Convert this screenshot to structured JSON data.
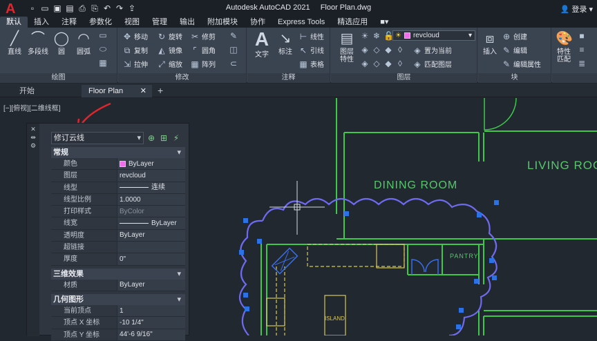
{
  "app": {
    "title_app": "Autodesk AutoCAD 2021",
    "title_doc": "Floor Plan.dwg",
    "signin_label": "登录"
  },
  "ribbon_tabs": [
    "默认",
    "插入",
    "注释",
    "参数化",
    "视图",
    "管理",
    "输出",
    "附加模块",
    "协作",
    "Express Tools",
    "精选应用"
  ],
  "ribbon": {
    "draw": {
      "title": "绘图",
      "line": "直线",
      "polyline": "多段线",
      "circle": "圆",
      "arc": "圆弧"
    },
    "modify": {
      "title": "修改",
      "move": "移动",
      "rotate": "旋转",
      "trim": "修剪",
      "copy": "复制",
      "mirror": "镜像",
      "fillet": "圆角",
      "stretch": "拉伸",
      "scale": "缩放",
      "array": "阵列"
    },
    "annotation": {
      "title": "注释",
      "text": "文字",
      "dimension": "标注",
      "linear": "线性",
      "leader": "引线",
      "table": "表格"
    },
    "layers": {
      "title": "图层",
      "layer_properties": "图层\n特性",
      "current_layer": "revcloud",
      "set_current": "置为当前",
      "match_layer": "匹配图层"
    },
    "block": {
      "title": "块",
      "insert": "插入",
      "create": "创建",
      "edit": "编辑",
      "edit_attributes": "编辑属性"
    },
    "properties": {
      "match_properties": "特性\n匹配"
    }
  },
  "doc_tabs": {
    "start": "开始",
    "floor_plan": "Floor Plan"
  },
  "viewport_label": "[−][俯视][二维线框]",
  "drawing": {
    "living_room": "LIVING ROOM",
    "dining_room": "DINING ROOM",
    "pantry": "PANTRY",
    "island": "ISLAND"
  },
  "properties_palette": {
    "selection": "修订云线",
    "sections": {
      "general": "常规",
      "3d": "三维效果",
      "geometry": "几何图形"
    },
    "general_rows": [
      {
        "key": "颜色",
        "value": "ByLayer"
      },
      {
        "key": "图层",
        "value": "revcloud"
      },
      {
        "key": "线型",
        "value": "连续"
      },
      {
        "key": "线型比例",
        "value": "1.0000"
      },
      {
        "key": "打印样式",
        "value": "ByColor"
      },
      {
        "key": "线宽",
        "value": "ByLayer"
      },
      {
        "key": "透明度",
        "value": "ByLayer"
      },
      {
        "key": "超链接",
        "value": ""
      },
      {
        "key": "厚度",
        "value": "0\""
      }
    ],
    "3d_rows": [
      {
        "key": "材质",
        "value": "ByLayer"
      }
    ],
    "geometry_rows": [
      {
        "key": "当前顶点",
        "value": "1"
      },
      {
        "key": "顶点 X 坐标",
        "value": "-10 1/4\""
      },
      {
        "key": "顶点 Y 坐标",
        "value": "44'-6 9/16\""
      }
    ]
  },
  "colors": {
    "wall_green": "#3fc94a",
    "label_green": "#55c96a",
    "revcloud_blue": "#6f6bf0",
    "kitchen_yellow": "#d7c75a",
    "swatch_magenta": "#ee6ee9",
    "arrow_red": "#e0252c"
  }
}
